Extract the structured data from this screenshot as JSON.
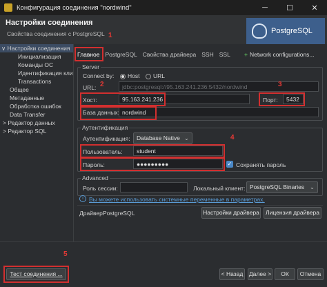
{
  "window": {
    "title": "Конфигурация соединения \"nordwind\""
  },
  "header": {
    "title": "Настройки соединения",
    "subtitle": "Свойства соединения с PostgreSQL",
    "logo_text": "PostgreSQL"
  },
  "tree": {
    "items": [
      {
        "label": "Настройки соединения",
        "prefix": "∨"
      },
      {
        "label": "Инициализация",
        "prefix": ""
      },
      {
        "label": "Команды ОС",
        "prefix": ""
      },
      {
        "label": "Идентификация кли",
        "prefix": ""
      },
      {
        "label": "Transactions",
        "prefix": ""
      },
      {
        "label": "Общее",
        "prefix": ""
      },
      {
        "label": "Метаданные",
        "prefix": ""
      },
      {
        "label": "Обработка ошибок",
        "prefix": ""
      },
      {
        "label": "Data Transfer",
        "prefix": ""
      },
      {
        "label": "Редактор данных",
        "prefix": ">"
      },
      {
        "label": "Редактор SQL",
        "prefix": ">"
      }
    ]
  },
  "tabs": [
    "Главное",
    "PostgreSQL",
    "Свойства драйвера",
    "SSH",
    "SSL"
  ],
  "network_config": "Network configurations...",
  "server": {
    "group": "Server",
    "connect_by": "Connect by:",
    "opt_host": "Host",
    "opt_url": "URL",
    "url_label": "URL:",
    "url_value": "jdbc:postgresql://95.163.241.236:5432/nordwind",
    "host_label": "Хост:",
    "host_value": "95.163.241.236",
    "port_label": "Порт:",
    "port_value": "5432",
    "db_label": "База данных:",
    "db_value": "nordwind"
  },
  "auth": {
    "group": "Аутентификация",
    "auth_label": "Аутентификация:",
    "auth_value": "Database Native",
    "user_label": "Пользователь:",
    "user_value": "student",
    "pass_label": "Пароль:",
    "pass_value": "●●●●●●●●●",
    "save_pass": "Сохранять пароль"
  },
  "advanced": {
    "group": "Advanced",
    "role_label": "Роль сессии:",
    "client_label": "Локальный клиент:",
    "client_value": "PostgreSQL Binaries"
  },
  "hint": "Вы можете использовать системные переменные в параметрах.",
  "driver": {
    "label": "Драйвер:",
    "value": "PostgreSQL",
    "settings_btn": "Настройки драйвера",
    "license_btn": "Лицензия драйвера"
  },
  "footer": {
    "test_btn": "Тест соединения ...",
    "back_btn": "< Назад",
    "next_btn": "Далее >",
    "ok_btn": "ОК",
    "cancel_btn": "Отмена"
  },
  "annotations": [
    "1",
    "2",
    "3",
    "4",
    "5"
  ],
  "colors": {
    "highlight": "#d32f2f",
    "accent": "#4a88c7",
    "logo_bg": "#3d5f8c"
  }
}
